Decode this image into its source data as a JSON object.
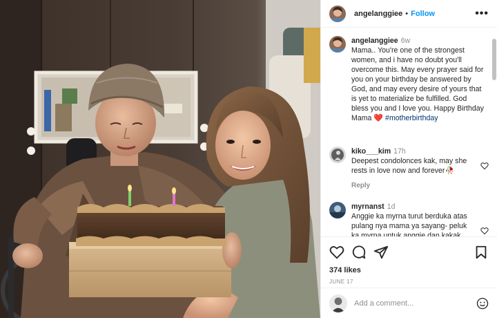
{
  "post": {
    "author": {
      "username": "angelanggiee",
      "follow_label": "Follow",
      "dot": "•"
    },
    "more_label": "•••",
    "caption": {
      "username": "angelanggiee",
      "time": "6w",
      "text": "Mama.. You're one of the strongest women, and i have no doubt you'll overcome this. May every prayer said for you on your birthday be answered by God, and may every desire of yours that is yet to materialize be fulfilled. God bless you and I love you. Happy Birthday Mama ",
      "emoji": "❤️",
      "hashtag": "#motherbirthday"
    },
    "comments": [
      {
        "username": "kiko___kim",
        "time": "17h",
        "text": "Deepest condolonces kak, may she rests in love now and forever",
        "emoji": "🥀",
        "reply_label": "Reply"
      },
      {
        "username": "myrnanst",
        "time": "1d",
        "text": "Anggie ka myrna turut berduka atas pulang nya mama ya sayang- peluk ka myrna untuk anggie dan kakak",
        "emoji": ""
      }
    ],
    "likes": "374 likes",
    "date": "JUNE 17",
    "comment_placeholder": "Add a comment...",
    "icons": {
      "like": "heart-icon",
      "comment": "comment-icon",
      "share": "share-icon",
      "save": "bookmark-icon",
      "emoji": "emoji-icon",
      "more": "more-icon"
    },
    "colors": {
      "link": "#0095f6",
      "hashtag": "#00376b",
      "muted": "#8e8e8e",
      "text": "#262626"
    }
  }
}
